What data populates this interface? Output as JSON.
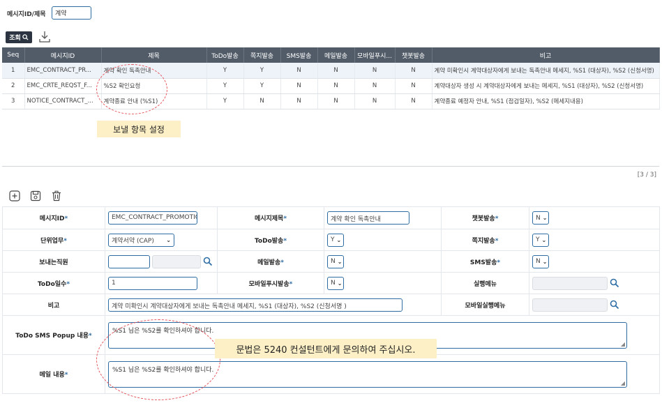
{
  "search": {
    "label": "메시지ID/제목",
    "value": "계약"
  },
  "toolbar": {
    "query_label": "조회"
  },
  "grid": {
    "columns": [
      "Seq",
      "메시지ID",
      "제목",
      "ToDo발송",
      "쪽지발송",
      "SMS발송",
      "메일발송",
      "모바일푸시...",
      "챗봇발송",
      "비고"
    ],
    "rows": [
      [
        "1",
        "EMC_CONTRACT_PR...",
        "계약 확인 독촉안내",
        "Y",
        "Y",
        "N",
        "N",
        "N",
        "N",
        "계약 미확인시 계약대상자에게 보내는 독촉안내 메세지, %S1 (대상자), %S2 (신청서명)"
      ],
      [
        "2",
        "EMC_CRTE_REQST_F...",
        "%S2 확인요청",
        "Y",
        "Y",
        "N",
        "N",
        "N",
        "N",
        "계약대상자 생성 시 계약대상자에게 보내는 메세지, %S1 (대상자), %S2 (신청서명)"
      ],
      [
        "3",
        "NOTICE_CONTRACT_...",
        "계약종료 안내 (%S1)",
        "Y",
        "N",
        "N",
        "N",
        "N",
        "N",
        "계약종료 예정자 안내, %S1 (점검일자), %S2 (메세지내용)"
      ]
    ]
  },
  "annotations": {
    "first": "보낼 항목 설정",
    "second": "문법은 5240 컨설턴트에게 문의하여 주십시오."
  },
  "pagination": "[3 / 3]",
  "form": {
    "msg_id_label": "메시지ID",
    "msg_id_value": "EMC_CONTRACT_PROMOTION",
    "msg_title_label": "메시지제목",
    "msg_title_value": "계약 확인 독촉안내",
    "chatbot_label": "챗봇발송",
    "chatbot_value": "N",
    "unit_label": "단위업무",
    "unit_value": "계약서약 (CAP)",
    "todo_label": "ToDo발송",
    "todo_value": "Y",
    "note_msg_label": "쪽지발송",
    "note_msg_value": "Y",
    "sender_label": "보내는직원",
    "sender_value": "",
    "mail_send_label": "메일발송",
    "mail_send_value": "N",
    "sms_label": "SMS발송",
    "sms_value": "N",
    "todo_days_label": "ToDo일수",
    "todo_days_value": "1",
    "push_label": "모바일푸시발송",
    "push_value": "N",
    "menu_label": "실행메뉴",
    "remark_label": "비고",
    "remark_value": "계약 미확인시 계약대상자에게 보내는 독촉안내 메세지, %S1 (대상자), %S2 (신청서명 )",
    "mobile_menu_label": "모바일실행메뉴",
    "popup_label": "ToDo SMS Popup 내용",
    "popup_value": "%S1 님은 %S2를 확인하셔야 합니다.",
    "mail_content_label": "메일 내용",
    "mail_content_value": "%S1 님은 %S2를 확인하셔야 합니다."
  },
  "colors": {
    "header_bg": "#525c68",
    "accent": "#2e6da4",
    "annotation_bg": "#fdf0c6",
    "annotation_circle": "#e5535a"
  }
}
